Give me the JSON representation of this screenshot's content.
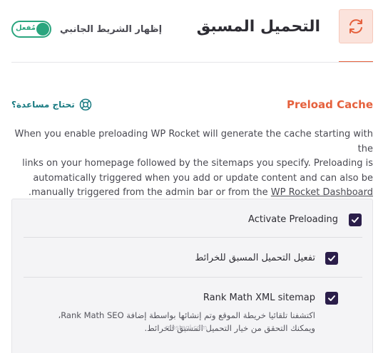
{
  "header": {
    "title": "التحميل المسبق",
    "icon": "refresh-icon",
    "sidebar_toggle_label": "إظهار الشريط الجانبي",
    "sidebar_toggle_state": "مُفعل",
    "sidebar_toggle_on": true
  },
  "section": {
    "title": "Preload Cache",
    "help_label": "تحتاج مساعدة؟",
    "help_icon": "lifebuoy-icon",
    "description_lines": [
      "When you enable preloading WP Rocket will generate the cache starting with the",
      "links on your homepage followed by the sitemaps you specify. Preloading is",
      "automatically triggered when you add or update content and can also be"
    ],
    "description_last_prefix": ".manually triggered from the admin bar or from the",
    "description_link": "WP Rocket Dashboard"
  },
  "options": [
    {
      "label": "Activate Preloading",
      "checked": true
    },
    {
      "label": "تفعيل التحميل المسبق للخرائط",
      "checked": true
    },
    {
      "label": "Rank Math XML sitemap",
      "checked": true,
      "sub_line_1": "اكتشفنا تلقائيا خريطة الموقع وتم إنشائها بواسطة إضافة Rank Math SEO،",
      "sub_line_2": "ويمكنك التحقق من خيار التحميل المسبق للخرائط."
    }
  ],
  "watermark": "mostaql.com",
  "colors": {
    "accent": "#e5613d",
    "toggle_on": "#2aa57e",
    "help_link": "#187a81",
    "checkbox": "#2b1e4a"
  }
}
